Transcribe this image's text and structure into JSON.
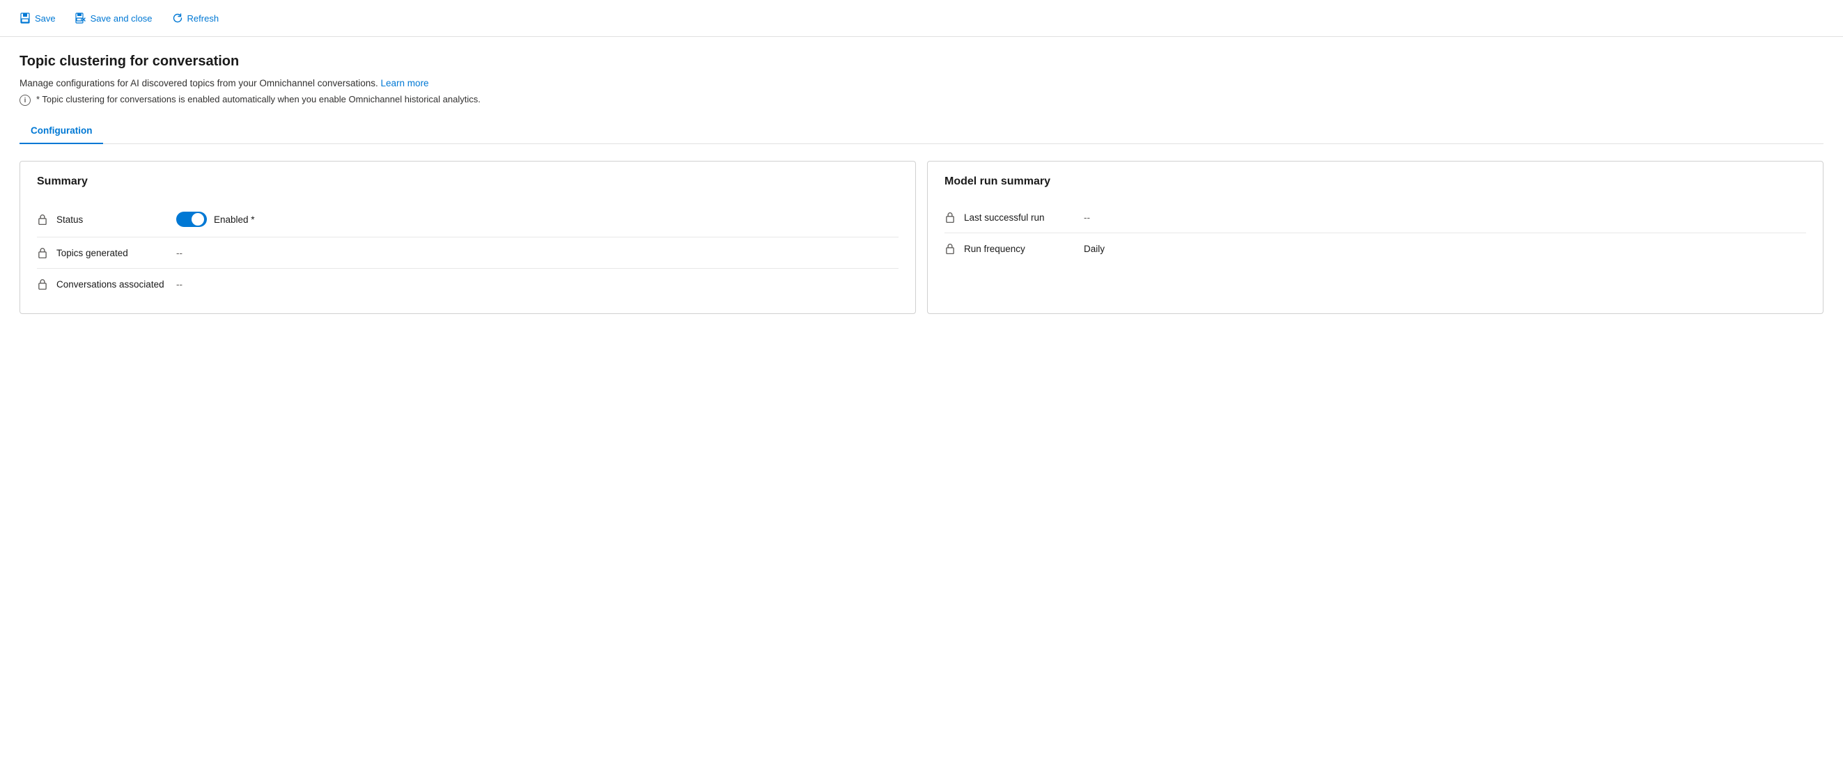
{
  "toolbar": {
    "save_label": "Save",
    "save_close_label": "Save and close",
    "refresh_label": "Refresh"
  },
  "page": {
    "title": "Topic clustering for conversation",
    "description": "Manage configurations for AI discovered topics from your Omnichannel conversations.",
    "learn_more_label": "Learn more",
    "info_note": "* Topic clustering for conversations is enabled automatically when you enable Omnichannel historical analytics."
  },
  "tabs": [
    {
      "label": "Configuration",
      "active": true
    }
  ],
  "summary_card": {
    "title": "Summary",
    "fields": [
      {
        "label": "Status",
        "type": "toggle",
        "toggle_enabled": true,
        "toggle_label": "Enabled *"
      },
      {
        "label": "Topics generated",
        "value": "--"
      },
      {
        "label": "Conversations associated",
        "value": "--"
      }
    ]
  },
  "model_run_card": {
    "title": "Model run summary",
    "fields": [
      {
        "label": "Last successful run",
        "value": "--"
      },
      {
        "label": "Run frequency",
        "value": "Daily"
      }
    ]
  }
}
